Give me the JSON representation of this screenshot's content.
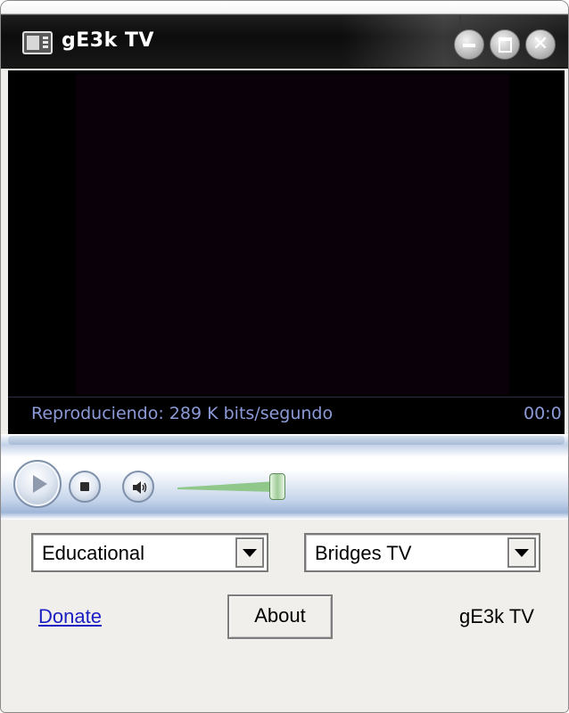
{
  "window": {
    "title": "gE3k TV",
    "icon": "tv-icon",
    "buttons": {
      "minimize": "minimize-icon",
      "maximize": "maximize-icon",
      "close": "close-icon",
      "close_glyph": "✕"
    }
  },
  "player": {
    "status": "Reproduciendo: 289 K bits/segundo",
    "time": "00:0",
    "icons": {
      "play": "play-icon",
      "stop": "stop-icon",
      "mute": "speaker-icon"
    },
    "volume_fraction": 0.95
  },
  "controls": {
    "category_value": "Educational",
    "channel_value": "Bridges TV",
    "donate_label": "Donate",
    "about_label": "About",
    "brand_label": "gE3k TV"
  },
  "colors": {
    "status_text": "#8c9ad8",
    "link": "#1b1ec2",
    "volume_fill": "#8fc88a"
  }
}
